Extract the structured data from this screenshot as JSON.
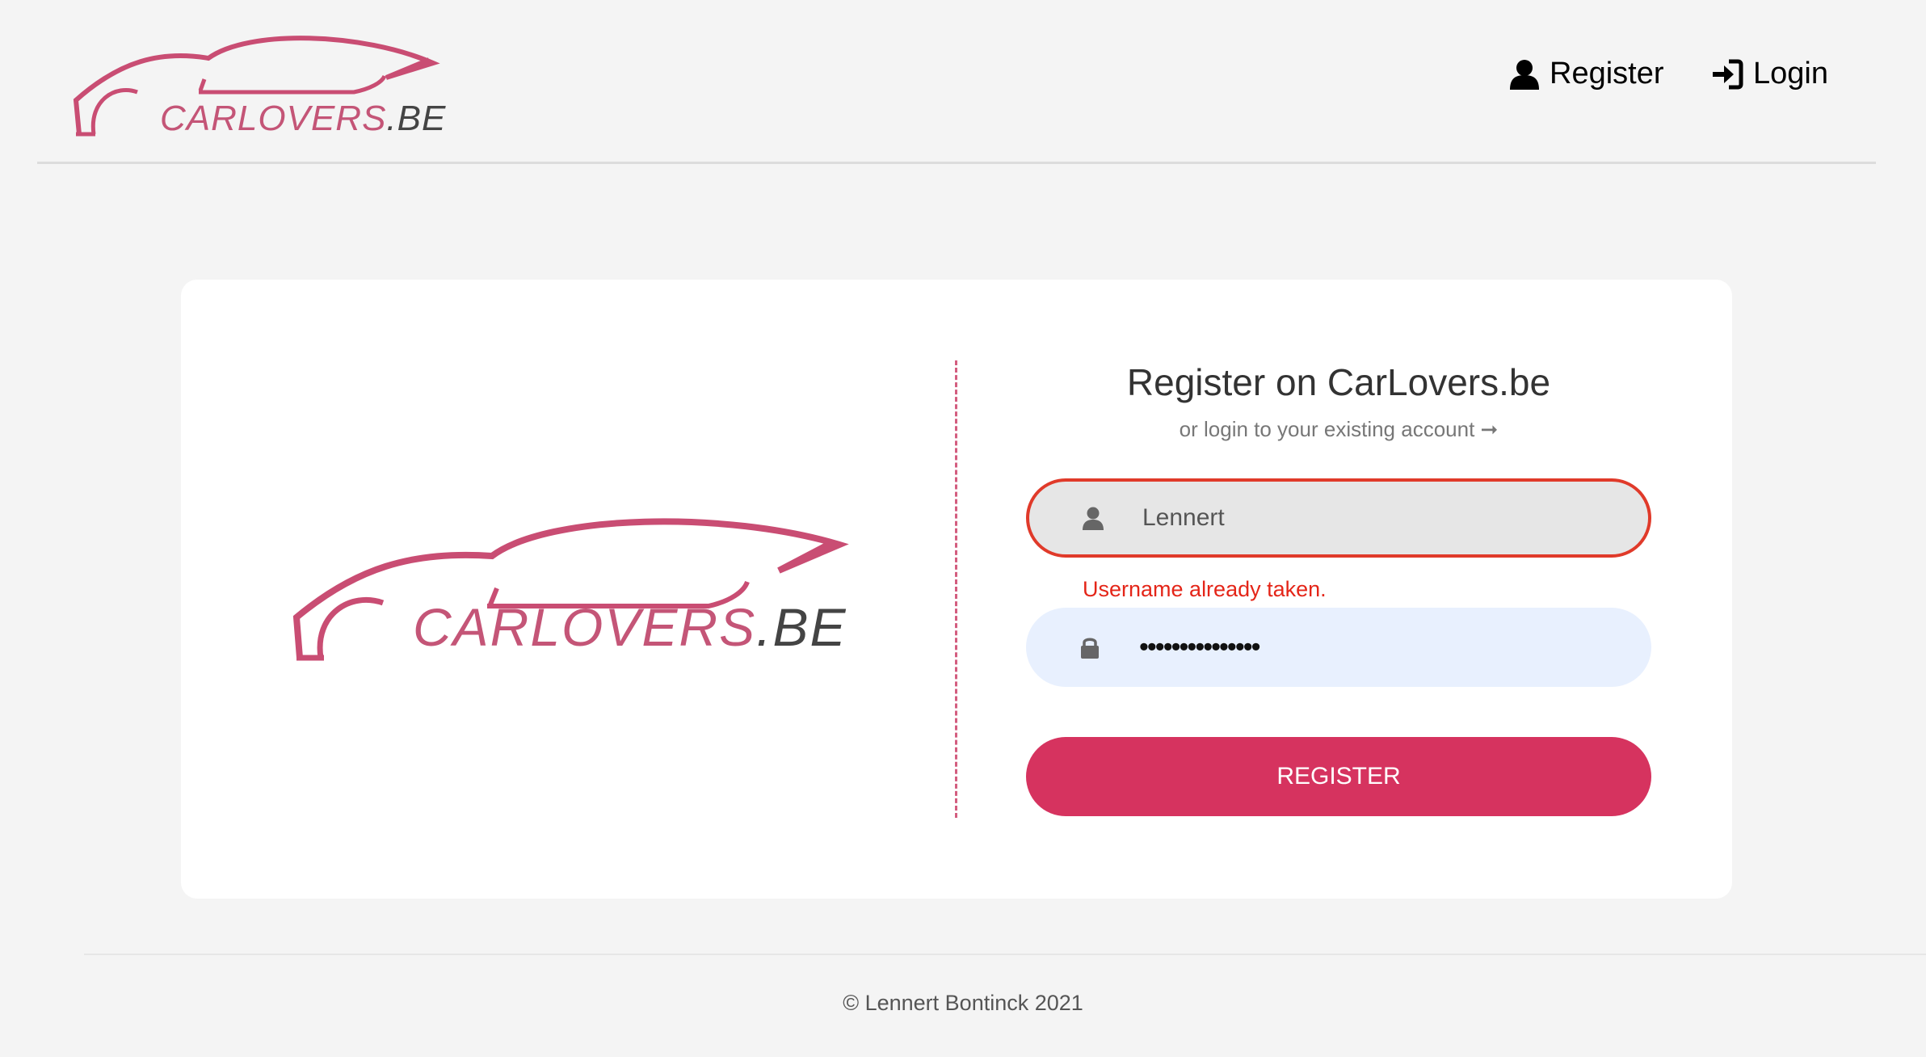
{
  "header": {
    "logo": {
      "brand": "CARLOVERS",
      "tld": ".BE"
    },
    "nav": {
      "register_label": "Register",
      "login_label": "Login"
    }
  },
  "card": {
    "logo": {
      "brand": "CARLOVERS",
      "tld": ".BE"
    },
    "form": {
      "title": "Register on CarLovers.be",
      "subtitle": "or login to your existing account ➞",
      "username_value": "Lennert",
      "username_error": "Username already taken.",
      "password_value": "•••••••••••••••",
      "submit_label": "REGISTER"
    }
  },
  "footer": {
    "copyright": "© Lennert Bontinck 2021"
  },
  "colors": {
    "brand": "#c45577",
    "button": "#d6335f",
    "error": "#e42518",
    "background": "#f4f4f4"
  },
  "icons": {
    "nav_register": "user-icon",
    "nav_login": "sign-in-icon",
    "username_field": "user-icon",
    "password_field": "lock-icon"
  }
}
